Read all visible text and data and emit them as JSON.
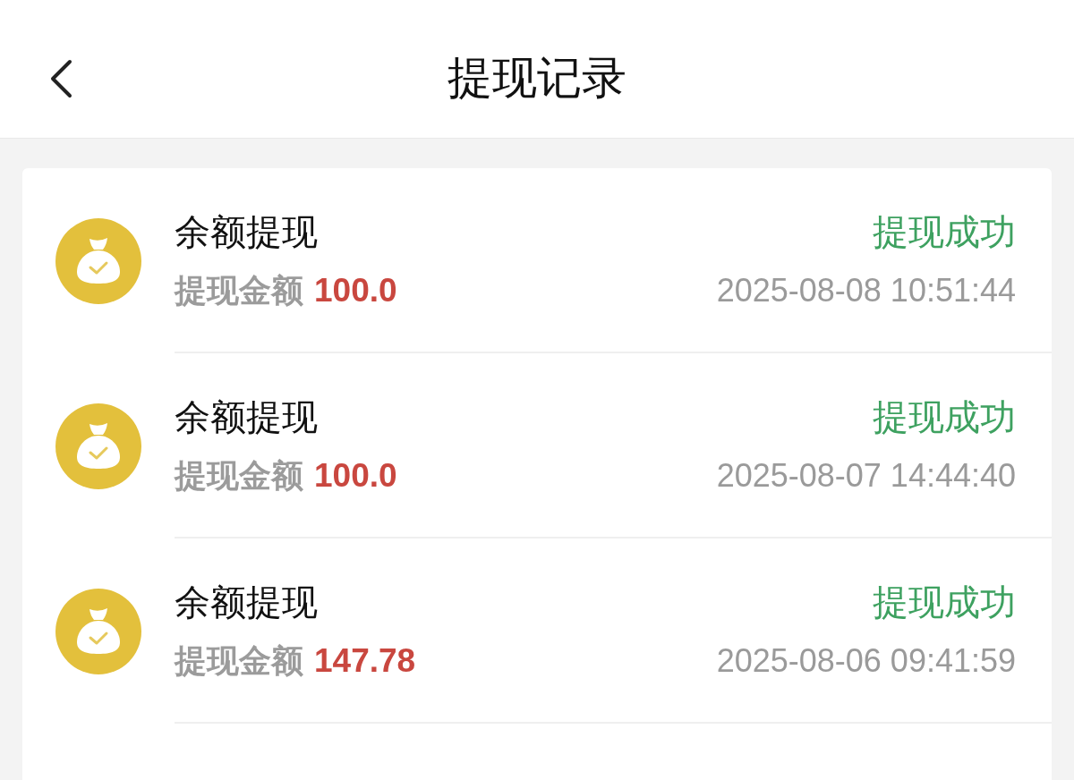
{
  "header": {
    "title": "提现记录"
  },
  "records": [
    {
      "title": "余额提现",
      "amount_label": "提现金额",
      "amount": "100.0",
      "status": "提现成功",
      "time": "2025-08-08 10:51:44"
    },
    {
      "title": "余额提现",
      "amount_label": "提现金额",
      "amount": "100.0",
      "status": "提现成功",
      "time": "2025-08-07 14:44:40"
    },
    {
      "title": "余额提现",
      "amount_label": "提现金额",
      "amount": "147.78",
      "status": "提现成功",
      "time": "2025-08-06 09:41:59"
    }
  ]
}
